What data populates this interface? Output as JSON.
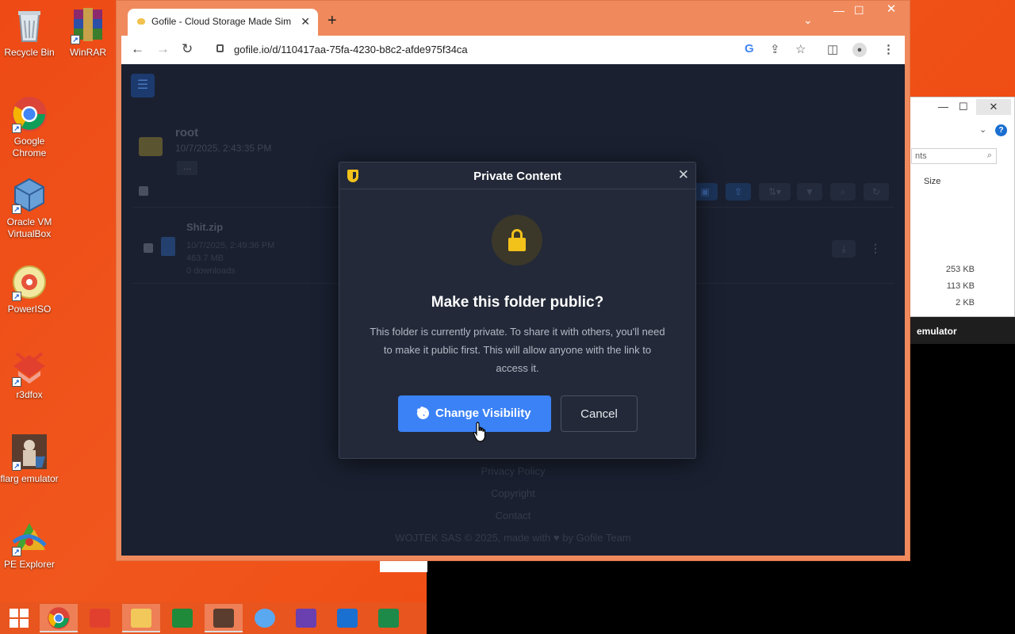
{
  "desktop": {
    "icons": [
      {
        "label": "Recycle Bin"
      },
      {
        "label": "WinRAR"
      },
      {
        "label": "Google Chrome"
      },
      {
        "label": "Oracle VM VirtualBox"
      },
      {
        "label": "PowerISO"
      },
      {
        "label": "r3dfox"
      },
      {
        "label": "flarg emulator"
      },
      {
        "label": "PE Explorer"
      }
    ]
  },
  "explorer": {
    "search_placeholder": "nts",
    "column_size": "Size",
    "sizes": [
      "253 KB",
      "113 KB",
      "2 KB"
    ],
    "bottom_label": "emulator"
  },
  "browser": {
    "tab_title": "Gofile - Cloud Storage Made Sim",
    "url": "gofile.io/d/110417aa-75fa-4230-b8c2-afde975f34ca"
  },
  "page": {
    "folder_name": "root",
    "folder_date": "10/7/2025, 2:43:35 PM",
    "more_label": "...",
    "file": {
      "name": "Shit.zip",
      "date": "10/7/2025, 2:49:36 PM",
      "size": "463.7 MB",
      "downloads": "0 downloads"
    },
    "footer": {
      "privacy": "Privacy Policy",
      "copyright": "Copyright",
      "contact": "Contact",
      "credit": "WOJTEK SAS © 2025, made with ♥ by Gofile Team"
    }
  },
  "modal": {
    "title": "Private Content",
    "question": "Make this folder public?",
    "description": "This folder is currently private. To share it with others, you'll need to make it public first. This will allow anyone with the link to access it.",
    "primary_label": "Change Visibility",
    "cancel_label": "Cancel"
  },
  "colors": {
    "accent": "#3b82f6",
    "warning": "#f2c21b",
    "desktop": "#ee4a15"
  }
}
